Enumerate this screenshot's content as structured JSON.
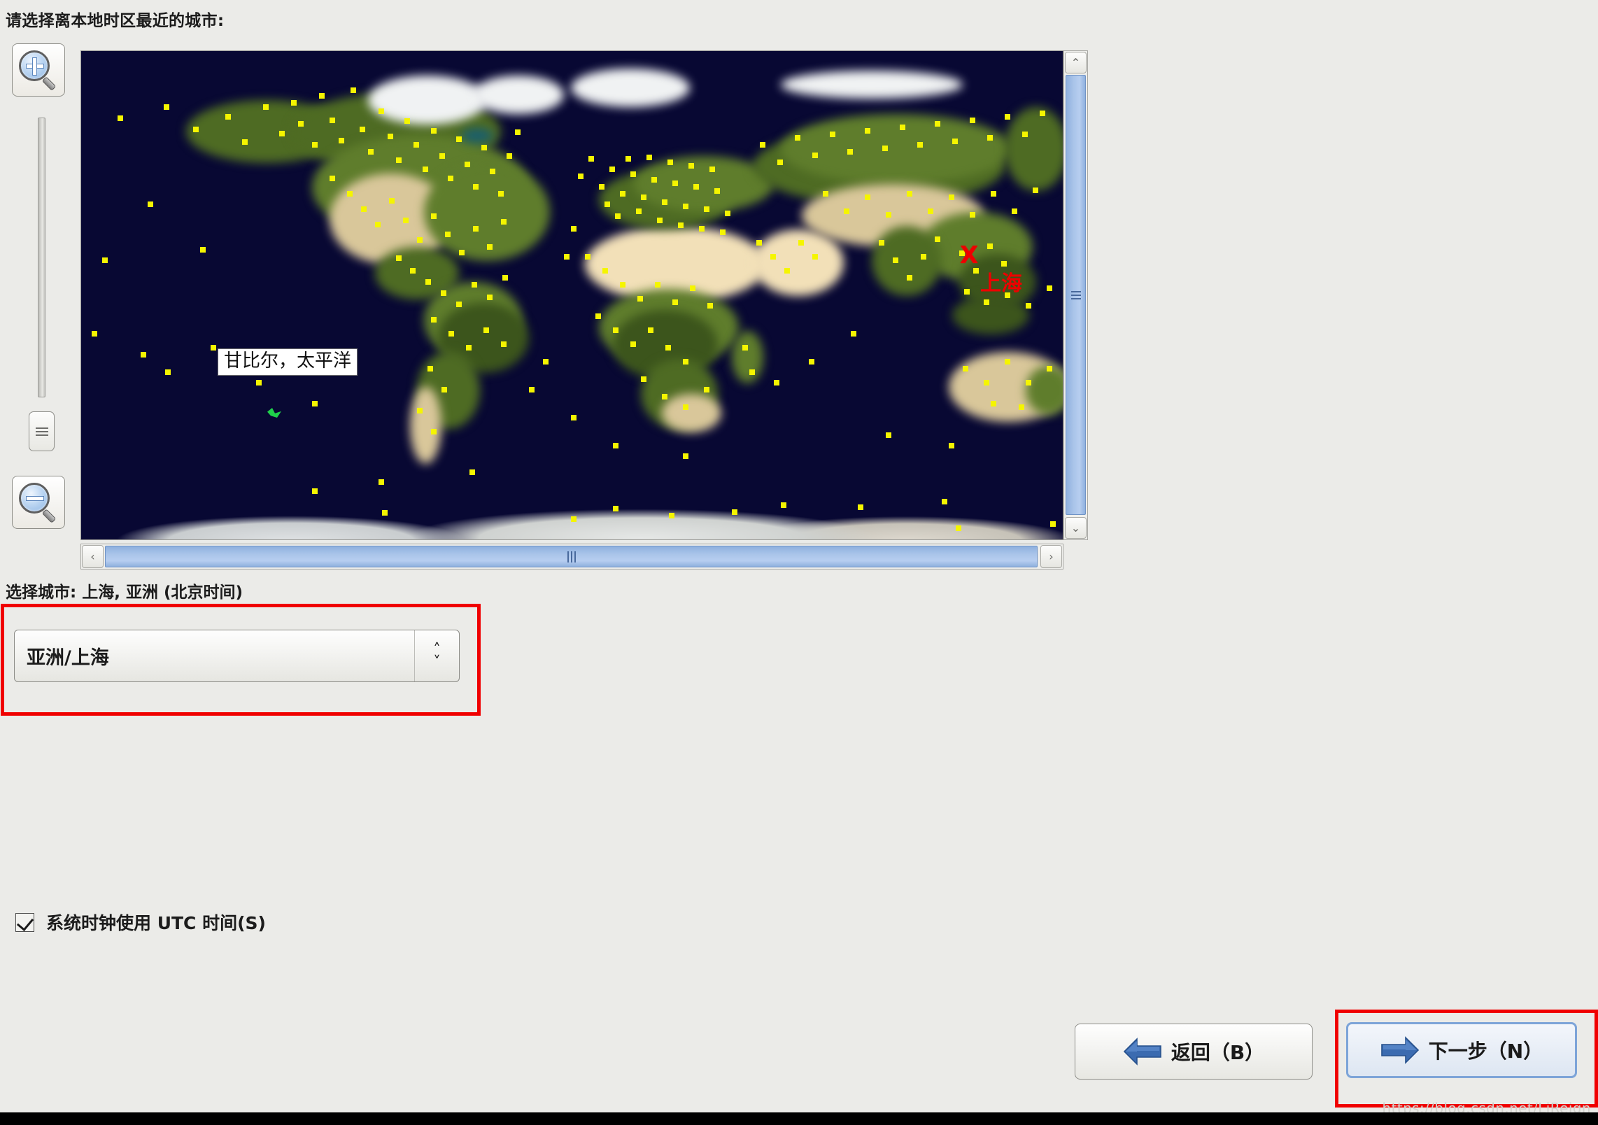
{
  "prompt": {
    "label": "请选择离本地时区最近的城市:"
  },
  "map": {
    "ocean_color": "#080833",
    "city_dot_color": "#f5f500",
    "selected_marker_glyph": "X",
    "selected_marker_color": "#ee0000",
    "selected_city_map_label": "上海",
    "hover_tooltip": "甘比尔，太平洋",
    "zoom_in_icon": "magnifier-plus-icon",
    "zoom_out_icon": "magnifier-minus-icon",
    "v_scroll_up_icon": "chevron-up-icon",
    "v_scroll_down_icon": "chevron-down-icon",
    "h_scroll_left_icon": "chevron-left-icon",
    "h_scroll_right_icon": "chevron-right-icon",
    "arrow_up_glyph": "⌃",
    "arrow_down_glyph": "⌄",
    "arrow_left_glyph": "‹",
    "arrow_right_glyph": "›"
  },
  "selection": {
    "city_line": "选择城市: 上海, 亚洲 (北京时间)",
    "timezone_value": "亚洲/上海",
    "spinner_up": "˄",
    "spinner_down": "˅"
  },
  "options": {
    "utc_checkbox_label": "系统时钟使用 UTC 时间(S)",
    "utc_checked": true
  },
  "footer": {
    "back_label": "返回（B）",
    "next_label": "下一步（N）"
  },
  "annotation": {
    "highlight_color": "#f00000"
  },
  "watermark": {
    "text": "https://blog.csdn.net/LiReign"
  }
}
